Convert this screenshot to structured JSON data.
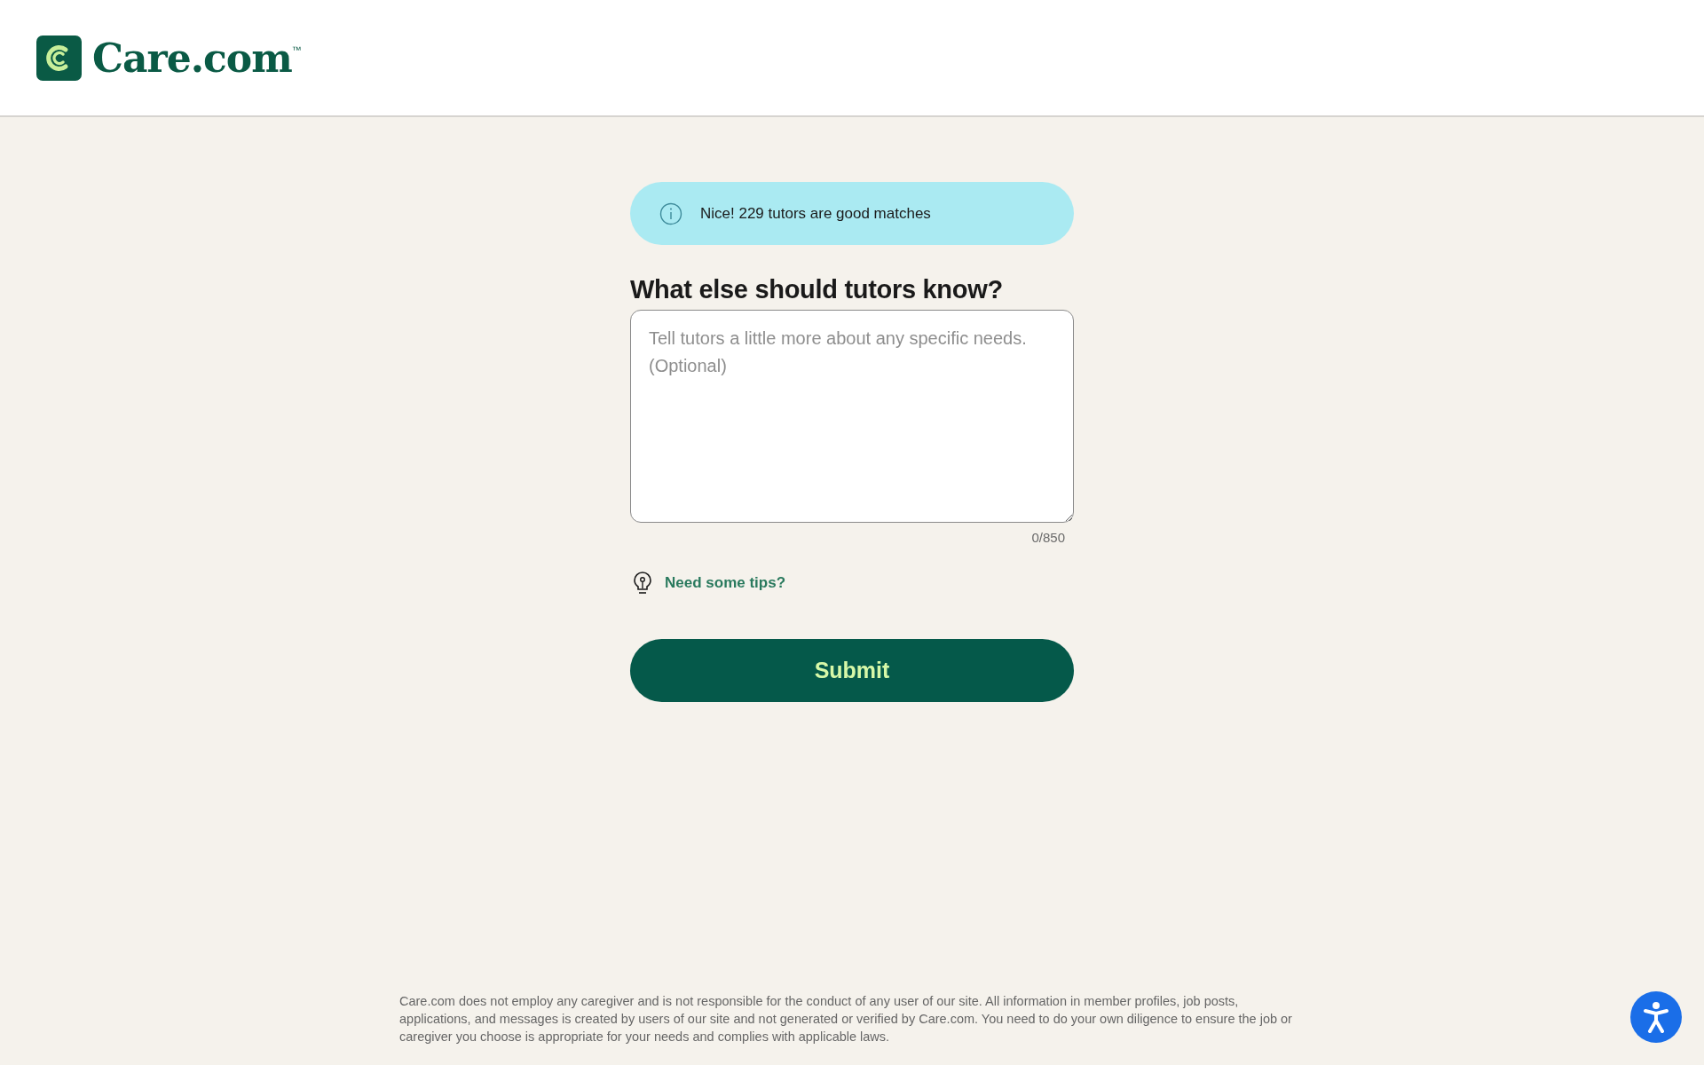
{
  "header": {
    "logo": {
      "wordmark": "Care.com",
      "trademark": "™"
    }
  },
  "banner": {
    "text": "Nice! 229 tutors are good matches"
  },
  "question": {
    "title": "What else should tutors know?",
    "placeholder": "Tell tutors a little more about any specific needs. (Optional)",
    "counter": "0/850"
  },
  "tips_link": "Need some tips?",
  "submit_button": "Submit",
  "disclaimer": "Care.com does not employ any caregiver and is not responsible for the conduct of any user of our site. All information in member profiles, job posts, applications, and messages is created by users of our site and not generated or verified by Care.com. You need to do your own diligence to ensure the job or caregiver you choose is appropriate for your needs and complies with applicable laws."
}
